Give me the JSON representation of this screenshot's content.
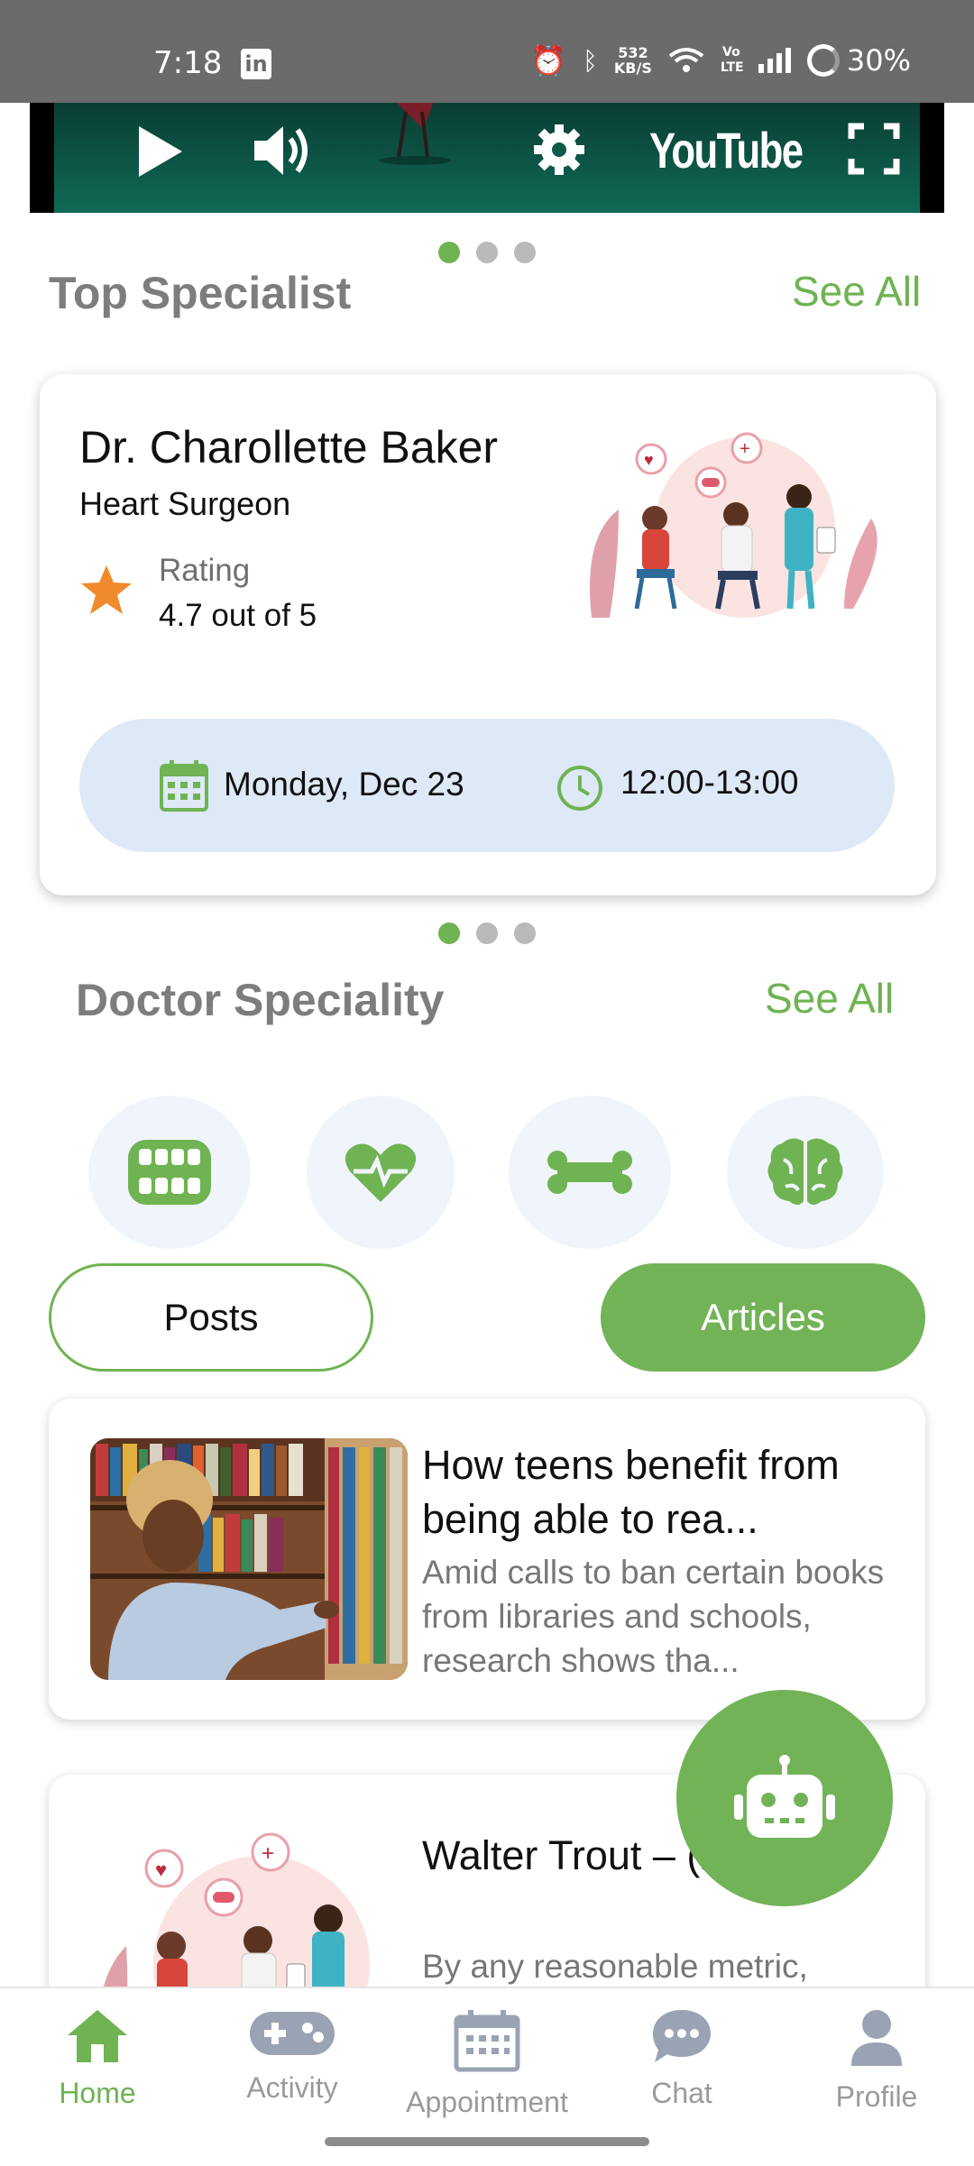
{
  "status_bar": {
    "time": "7:18",
    "app_icon": "LinkedIn",
    "speed_value": "532",
    "speed_unit": "KB/S",
    "network": "Vo LTE",
    "battery": "30%"
  },
  "video": {
    "brand": "YouTube"
  },
  "top_specialist": {
    "title": "Top Specialist",
    "see_all": "See All",
    "doctor": {
      "name": "Dr. Charollette Baker",
      "specialty": "Heart Surgeon",
      "rating_label": "Rating",
      "rating_value": "4.7 out of 5",
      "date": "Monday, Dec 23",
      "time": "12:00-13:00"
    }
  },
  "carousel": {
    "page_count": 3,
    "active_index": 0
  },
  "doctor_speciality": {
    "title": "Doctor Speciality",
    "see_all": "See All",
    "categories": [
      "teeth-icon",
      "heart-pulse-icon",
      "bone-icon",
      "brain-icon"
    ]
  },
  "content_tabs": {
    "posts": "Posts",
    "articles": "Articles",
    "selected": "Articles"
  },
  "articles": [
    {
      "title": "How teens benefit from being able to rea...",
      "description": "Amid calls to ban certain books from libraries and schools, research shows tha..."
    },
    {
      "title": "Walter Trout – (2024)",
      "description": "By any reasonable metric, "
    }
  ],
  "bottom_nav": [
    {
      "label": "Home",
      "icon": "home-icon",
      "active": true
    },
    {
      "label": "Activity",
      "icon": "gamepad-icon",
      "active": false
    },
    {
      "label": "Appointment",
      "icon": "calendar-icon",
      "active": false
    },
    {
      "label": "Chat",
      "icon": "chat-icon",
      "active": false
    },
    {
      "label": "Profile",
      "icon": "profile-icon",
      "active": false
    }
  ],
  "colors": {
    "accent_green": "#72b357",
    "appointment_bg": "#dde9f6",
    "status_bar": "#6b6b6b",
    "star_orange": "#f08a2c"
  }
}
